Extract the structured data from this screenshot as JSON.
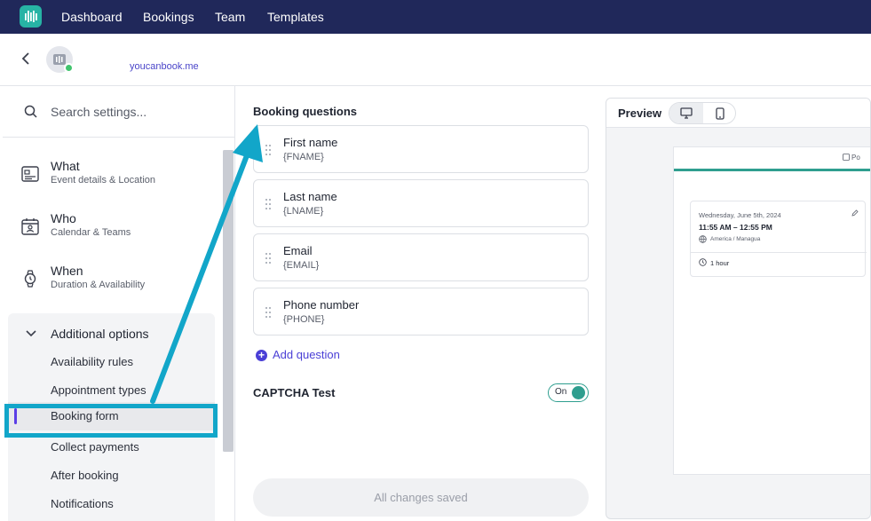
{
  "topnav": {
    "items": [
      "Dashboard",
      "Bookings",
      "Team",
      "Templates"
    ]
  },
  "header": {
    "brand": "youcanbook.me"
  },
  "sidebar": {
    "search_placeholder": "Search settings...",
    "sections": [
      {
        "title": "What",
        "subtitle": "Event details & Location",
        "icon": "id-card-icon"
      },
      {
        "title": "Who",
        "subtitle": "Calendar & Teams",
        "icon": "calendar-person-icon"
      },
      {
        "title": "When",
        "subtitle": "Duration & Availability",
        "icon": "watch-icon"
      }
    ],
    "additional": {
      "title": "Additional options",
      "items": [
        "Availability rules",
        "Appointment types",
        "Booking form",
        "Collect payments",
        "After booking",
        "Notifications"
      ],
      "active": "Booking form"
    }
  },
  "booking": {
    "title": "Booking questions",
    "questions": [
      {
        "label": "First name",
        "var": "{FNAME}"
      },
      {
        "label": "Last name",
        "var": "{LNAME}"
      },
      {
        "label": "Email",
        "var": "{EMAIL}"
      },
      {
        "label": "Phone number",
        "var": "{PHONE}"
      }
    ],
    "add_question": "Add question",
    "captcha_label": "CAPTCHA Test",
    "captcha_state": "On",
    "save_status": "All changes saved"
  },
  "preview": {
    "title": "Preview",
    "tag": "Po",
    "date": "Wednesday, June 5th, 2024",
    "time": "11:55 AM – 12:55 PM",
    "timezone": "America / Managua",
    "duration": "1 hour"
  },
  "colors": {
    "nav_bg": "#20285a",
    "accent_purple": "#4a3fd6",
    "teal": "#2f9e8f",
    "annotation": "#12a6c9"
  }
}
